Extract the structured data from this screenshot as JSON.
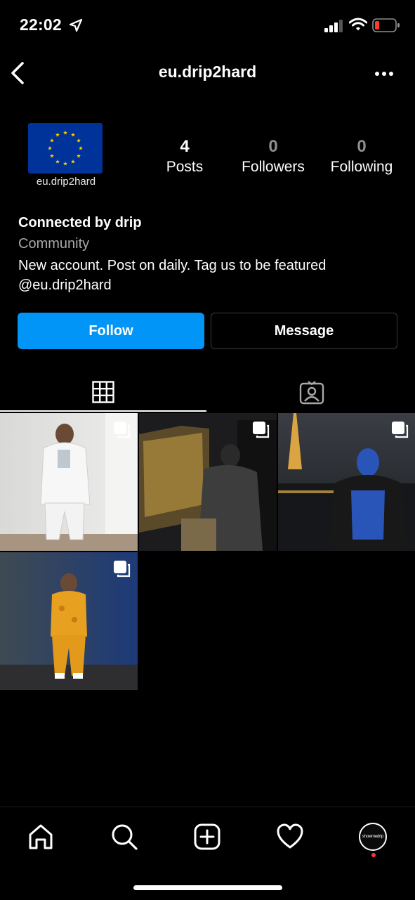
{
  "status_bar": {
    "time": "22:02"
  },
  "header": {
    "username": "eu.drip2hard"
  },
  "profile": {
    "avatar_caption": "eu.drip2hard",
    "stats": [
      {
        "value": "4",
        "label": "Posts"
      },
      {
        "value": "0",
        "label": "Followers"
      },
      {
        "value": "0",
        "label": "Following"
      }
    ],
    "bio": {
      "name": "Connected by drip",
      "category": "Community",
      "text": "New account. Post on daily. Tag us to be featured @eu.drip2hard"
    }
  },
  "actions": {
    "follow_label": "Follow",
    "message_label": "Message"
  },
  "tabs": [
    "grid-icon",
    "tagged-icon"
  ],
  "posts": [
    {
      "description": "man in white tracksuit",
      "multi": true
    },
    {
      "description": "man in car back seat",
      "multi": true
    },
    {
      "description": "person in blue hoodie near eiffel tower at night",
      "multi": true
    },
    {
      "description": "man in yellow camo tracksuit",
      "multi": true
    }
  ],
  "bottom_nav": [
    "home-icon",
    "search-icon",
    "create-icon",
    "activity-icon",
    "profile-avatar"
  ],
  "nav_avatar_text": "showmedrip",
  "colors": {
    "accent": "#0095f6",
    "background": "#000000",
    "notification": "#ff3040"
  }
}
